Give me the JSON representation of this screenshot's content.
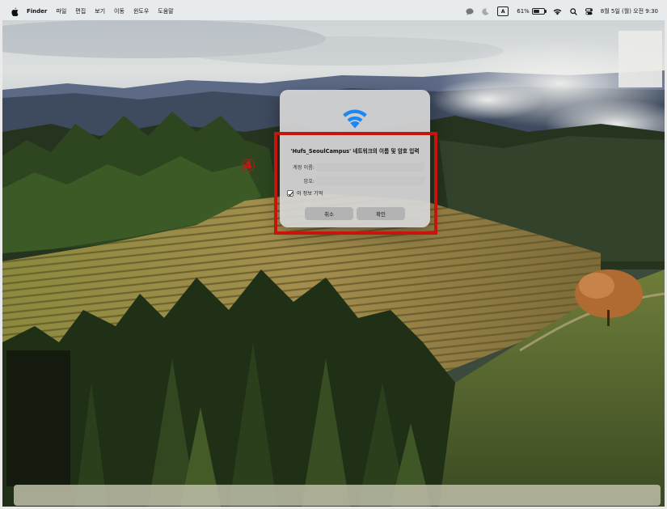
{
  "menubar": {
    "app_name": "Finder",
    "menus": [
      "파일",
      "편집",
      "보기",
      "이동",
      "윈도우",
      "도움말"
    ],
    "input_source": "A",
    "battery_percent": "61%",
    "battery_level": 0.61,
    "datetime": "8월 5일 (월) 오전 9:30"
  },
  "dialog": {
    "title": "'Hufs_SeoulCampus' 네트워크의 이름 및 암호 입력",
    "account_label": "계정 이름:",
    "account_value": "",
    "password_label": "암호:",
    "password_value": "",
    "remember_label": "이 정보 기억",
    "remember_checked": true,
    "cancel_label": "취소",
    "ok_label": "확인"
  },
  "annotation": {
    "step_marker": "④",
    "highlight_color": "#c8140f"
  },
  "colors": {
    "accent": "#1a87f5"
  }
}
